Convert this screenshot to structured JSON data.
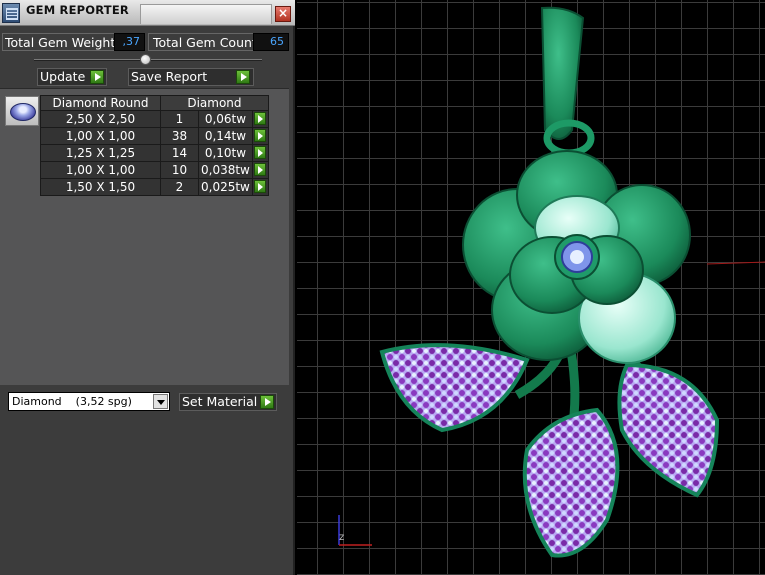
{
  "window": {
    "title": "GEM REPORTER",
    "close_glyph": "×"
  },
  "summary": {
    "total_weight_label": "Total Gem Weight",
    "total_weight_value": ",37",
    "total_count_label": "Total Gem Count",
    "total_count_value": "65"
  },
  "toolbar": {
    "update_label": "Update",
    "save_label": "Save Report"
  },
  "gem_table": {
    "headers": [
      "Diamond Round",
      "Diamond"
    ],
    "rows": [
      {
        "size": "2,50 X 2,50",
        "count": "1",
        "weight": "0,06tw"
      },
      {
        "size": "1,00 X 1,00",
        "count": "38",
        "weight": "0,14tw"
      },
      {
        "size": "1,25 X 1,25",
        "count": "14",
        "weight": "0,10tw"
      },
      {
        "size": "1,00 X 1,00",
        "count": "10",
        "weight": "0,038tw"
      },
      {
        "size": "1,50 X 1,50",
        "count": "2",
        "weight": "0,025tw"
      }
    ]
  },
  "material": {
    "selected": "Diamond    (3,52 spg)",
    "set_label": "Set Material"
  },
  "viewport": {
    "axis_label": "z"
  },
  "colors": {
    "accent_green": "#3a9a1c",
    "value_blue": "#4aa6ff",
    "metal": "#1e8c5e"
  }
}
